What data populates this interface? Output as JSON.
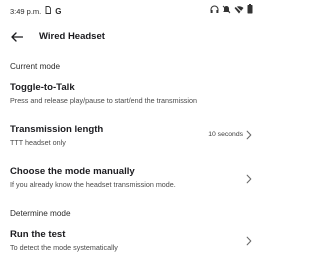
{
  "status_bar": {
    "time": "3:49 p.m.",
    "icons": [
      "sim-icon",
      "google-g-icon",
      "headset-icon",
      "mute-icon",
      "wifi-icon",
      "battery-icon"
    ]
  },
  "app_bar": {
    "title": "Wired Headset",
    "back_icon": "arrow-back-icon"
  },
  "sections": {
    "current_mode": {
      "header": "Current mode",
      "mode_title": "Toggle-to-Talk",
      "mode_description": "Press and release play/pause to start/end the transmission",
      "transmission_length_title": "Transmission length",
      "transmission_length_subtitle": "TTT headset only",
      "transmission_length_value": "10 seconds",
      "choose_manual_title": "Choose the mode manually",
      "choose_manual_subtitle": "If you already know the headset transmission mode."
    },
    "determine_mode": {
      "header": "Determine mode",
      "run_test_title": "Run the test",
      "run_test_subtitle": "To detect the mode systematically"
    }
  },
  "colors": {
    "background": "#ffffff",
    "text_primary": "#1b1b1f",
    "text_secondary": "#4a4a4a",
    "chevron": "#6b6b6b"
  }
}
